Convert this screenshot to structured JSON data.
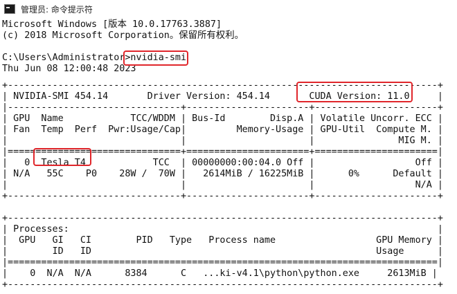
{
  "window": {
    "title": "管理员: 命令提示符",
    "icon": "cmd-icon"
  },
  "console": {
    "lines": [
      "Microsoft Windows [版本 10.0.17763.3887]",
      "(c) 2018 Microsoft Corporation。保留所有权利。",
      "",
      "C:\\Users\\Administrator>nvidia-smi",
      "Thu Jun 08 12:00:48 2023",
      "+-----------------------------------------------------------------------------+",
      "| NVIDIA-SMI 454.14       Driver Version: 454.14       CUDA Version: 11.0     |",
      "|-------------------------------+----------------------+----------------------+",
      "| GPU  Name            TCC/WDDM | Bus-Id        Disp.A | Volatile Uncorr. ECC |",
      "| Fan  Temp  Perf  Pwr:Usage/Cap|         Memory-Usage | GPU-Util  Compute M. |",
      "|                               |                      |               MIG M. |",
      "|===============================+======================+======================|",
      "|   0  Tesla T4            TCC  | 00000000:00:04.0 Off |                  Off |",
      "| N/A   55C    P0    28W /  70W |   2614MiB / 16225MiB |      0%      Default |",
      "|                               |                      |                  N/A |",
      "+-------------------------------+----------------------+----------------------+",
      "",
      "+-----------------------------------------------------------------------------+",
      "| Processes:                                                                  |",
      "|  GPU   GI   CI        PID   Type   Process name                  GPU Memory |",
      "|        ID   ID                                                   Usage      |",
      "|=============================================================================|",
      "|    0  N/A  N/A      8384      C   ...ki-v4.1\\python\\python.exe     2613MiB |",
      "+-----------------------------------------------------------------------------+"
    ]
  },
  "colors": {
    "background": "#ffffff",
    "text": "#111111",
    "highlight": "#e0262b"
  }
}
